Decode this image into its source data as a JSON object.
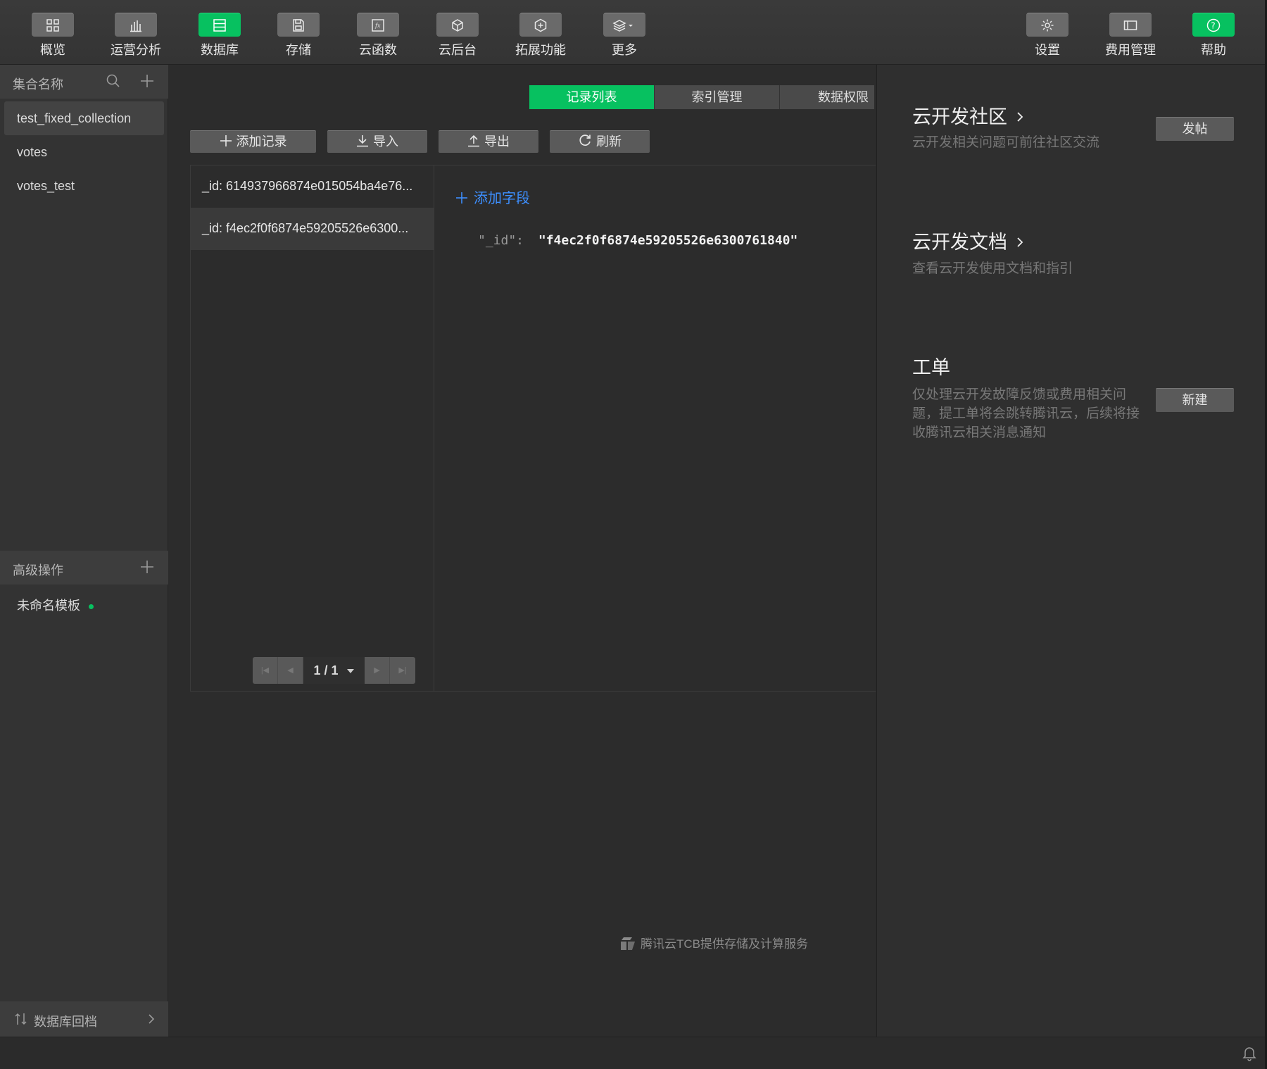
{
  "toolbar": {
    "items": [
      {
        "label": "概览",
        "icon": "dashboard-icon"
      },
      {
        "label": "运营分析",
        "icon": "bar-chart-icon"
      },
      {
        "label": "数据库",
        "icon": "database-icon",
        "active": true
      },
      {
        "label": "存储",
        "icon": "storage-icon"
      },
      {
        "label": "云函数",
        "icon": "function-icon"
      },
      {
        "label": "云后台",
        "icon": "cube-icon"
      },
      {
        "label": "拓展功能",
        "icon": "extension-icon"
      },
      {
        "label": "更多",
        "icon": "layers-icon"
      }
    ],
    "right_items": [
      {
        "label": "设置",
        "icon": "gear-icon"
      },
      {
        "label": "费用管理",
        "icon": "billing-icon"
      },
      {
        "label": "帮助",
        "icon": "help-icon",
        "active": true
      }
    ]
  },
  "sidebar": {
    "collections_header": "集合名称",
    "collections": [
      {
        "name": "test_fixed_collection",
        "selected": true
      },
      {
        "name": "votes"
      },
      {
        "name": "votes_test"
      }
    ],
    "advanced_header": "高级操作",
    "templates": [
      {
        "name": "未命名模板",
        "status_color": "#07c160"
      }
    ],
    "rollback_label": "数据库回档"
  },
  "main": {
    "tabs": [
      {
        "label": "记录列表",
        "active": true
      },
      {
        "label": "索引管理"
      },
      {
        "label": "数据权限"
      }
    ],
    "actions": {
      "add_record": "添加记录",
      "import": "导入",
      "export": "导出",
      "refresh": "刷新"
    },
    "records": [
      {
        "label": "_id: 614937966874e015054ba4e76..."
      },
      {
        "label": "_id: f4ec2f0f6874e59205526e6300...",
        "selected": true
      }
    ],
    "detail": {
      "add_field": "添加字段",
      "key": "\"_id\":",
      "value": "\"f4ec2f0f6874e59205526e6300761840\""
    },
    "pager": {
      "page_text": "1 / 1"
    },
    "footer_note": "腾讯云TCB提供存储及计算服务"
  },
  "right_panel": {
    "community_title": "云开发社区",
    "community_desc": "云开发相关问题可前往社区交流",
    "community_button": "发帖",
    "docs_title": "云开发文档",
    "docs_desc": "查看云开发使用文档和指引",
    "ticket_title": "工单",
    "ticket_desc": "仅处理云开发故障反馈或费用相关问题，提工单将会跳转腾讯云，后续将接收腾讯云相关消息通知",
    "ticket_button": "新建"
  },
  "colors": {
    "accent": "#07c160",
    "link": "#3d8fff",
    "background": "#2c2c2c"
  }
}
